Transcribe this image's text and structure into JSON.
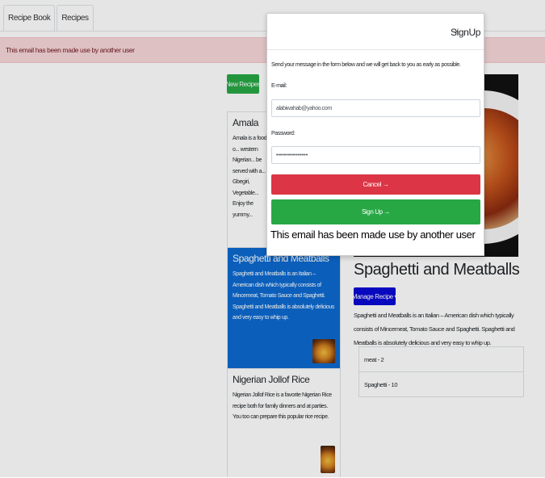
{
  "nav": {
    "tabs": [
      "Recipe Book",
      "Recipes"
    ]
  },
  "alert": {
    "text": "This email has been made use by another user"
  },
  "buttons": {
    "new_recipes": "New Recipes",
    "manage_recipe": "Manage Recipe",
    "manage_caret": "▾"
  },
  "recipes": [
    {
      "title": "Amala",
      "description": "Amala is a food o... western Nigerian... be served with a... Gbegiri, Vegetable... Enjoy the yummy..."
    },
    {
      "title": "Spaghetti and Meatballs",
      "description": "Spaghetti and Meatballs is an Italian – American dish which typically consists of Mincemeat, Tomato Sauce and Spaghetti. Spaghetti and Meatballs is absolutely delicious and very easy to whip up."
    },
    {
      "title": "Nigerian Jollof Rice",
      "description": "Nigerian Jollof Rice is a favorite Nigerian Rice recipe both for family dinners and at parties. You too can prepare this popular rice recipe."
    }
  ],
  "detail": {
    "title": "Spaghetti and Meatballs",
    "description": "Spaghetti and Meatballs is an Italian – American dish which typically consists of Mincemeat, Tomato Sauce and Spaghetti. Spaghetti and Meatballs is absolutely delicious and very easy to whip up.",
    "ingredients": [
      "meat - 2",
      "Spaghetti - 10"
    ]
  },
  "modal": {
    "close": "×",
    "title": "SignUp",
    "intro": "Send your message in the form below and we will get back to you as early as possible.",
    "email_label": "E-mail:",
    "email_value": "alabiwahab@yahoo.com",
    "password_label": "Password:",
    "password_value": "••••••••••••••••",
    "cancel": "Cancel →",
    "signup": "Sign Up →",
    "error": "This email has been made use by another user"
  },
  "colors": {
    "success": "#28a745",
    "danger": "#dc3545",
    "primary_active": "#0d6ad1",
    "manage": "#0a0ad4",
    "alert_bg": "#f8d7da"
  }
}
